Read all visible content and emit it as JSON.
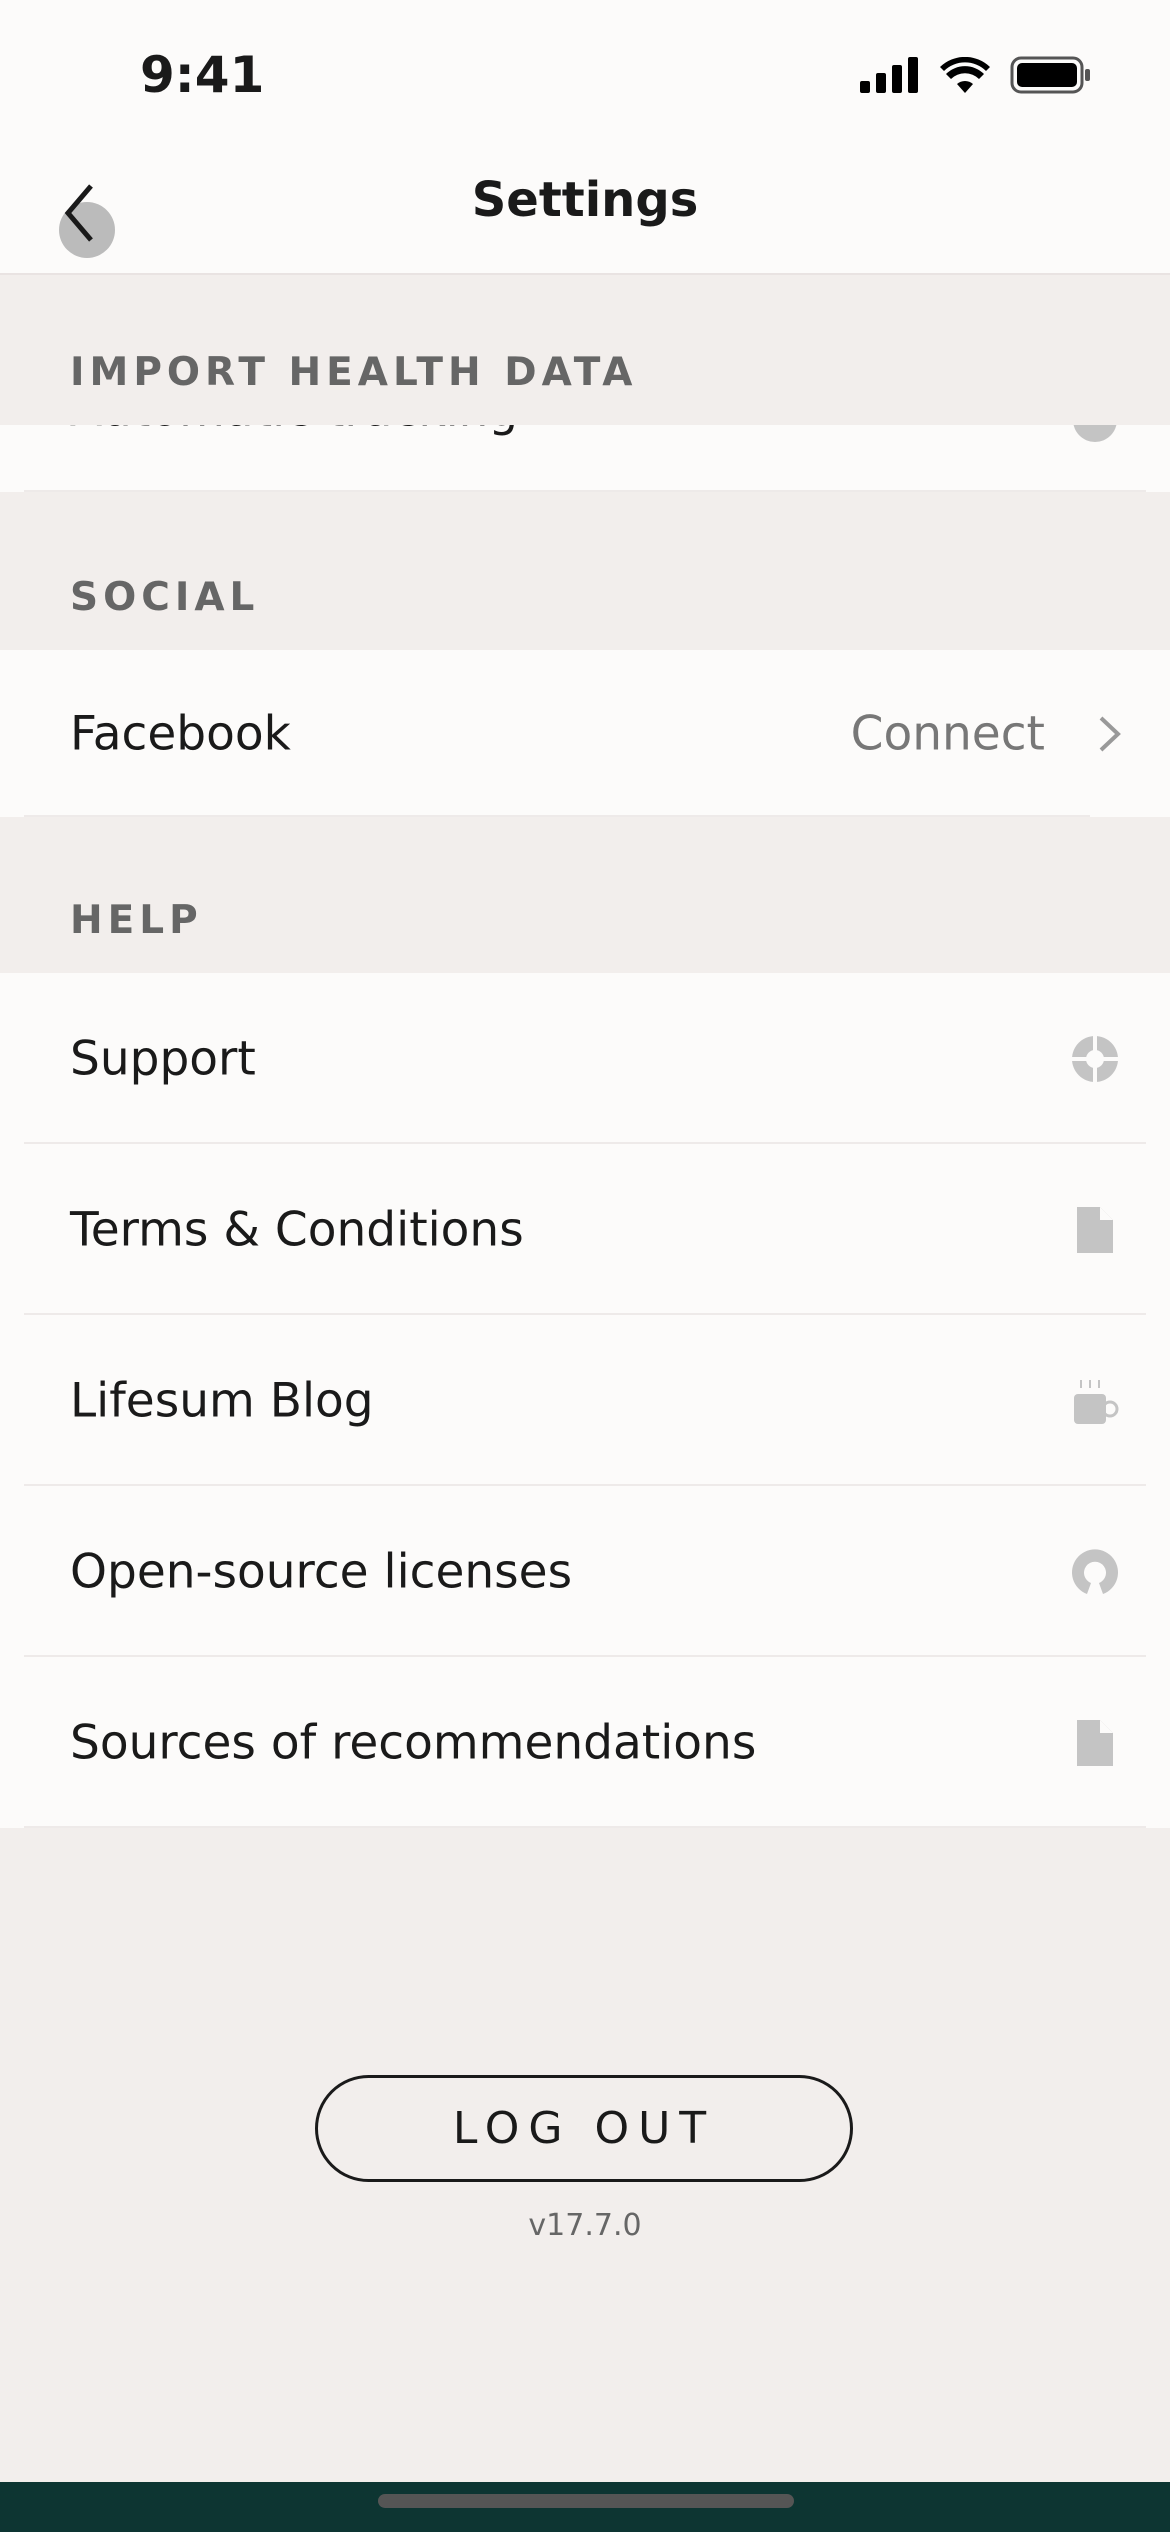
{
  "status": {
    "time": "9:41"
  },
  "nav": {
    "title": "Settings"
  },
  "sections": {
    "import": "IMPORT HEALTH DATA",
    "social": "SOCIAL",
    "help": "HELP"
  },
  "import_rows": [
    {
      "label": "Automatic tracking"
    }
  ],
  "social_rows": [
    {
      "label": "Facebook",
      "value": "Connect"
    }
  ],
  "help_rows": [
    {
      "label": "Support",
      "icon": "lifebuoy-icon"
    },
    {
      "label": "Terms & Conditions",
      "icon": "document-icon"
    },
    {
      "label": "Lifesum Blog",
      "icon": "coffee-cup-icon"
    },
    {
      "label": "Open-source licenses",
      "icon": "open-source-icon"
    },
    {
      "label": "Sources of recommendations",
      "icon": "document-icon"
    }
  ],
  "footer": {
    "logout": "LOG OUT",
    "version": "v17.7.0"
  },
  "colors": {
    "bottom_bar": "#0d3532",
    "background": "#f2eeec",
    "row": "#fcfbfa",
    "icon": "#c4c4c4"
  }
}
